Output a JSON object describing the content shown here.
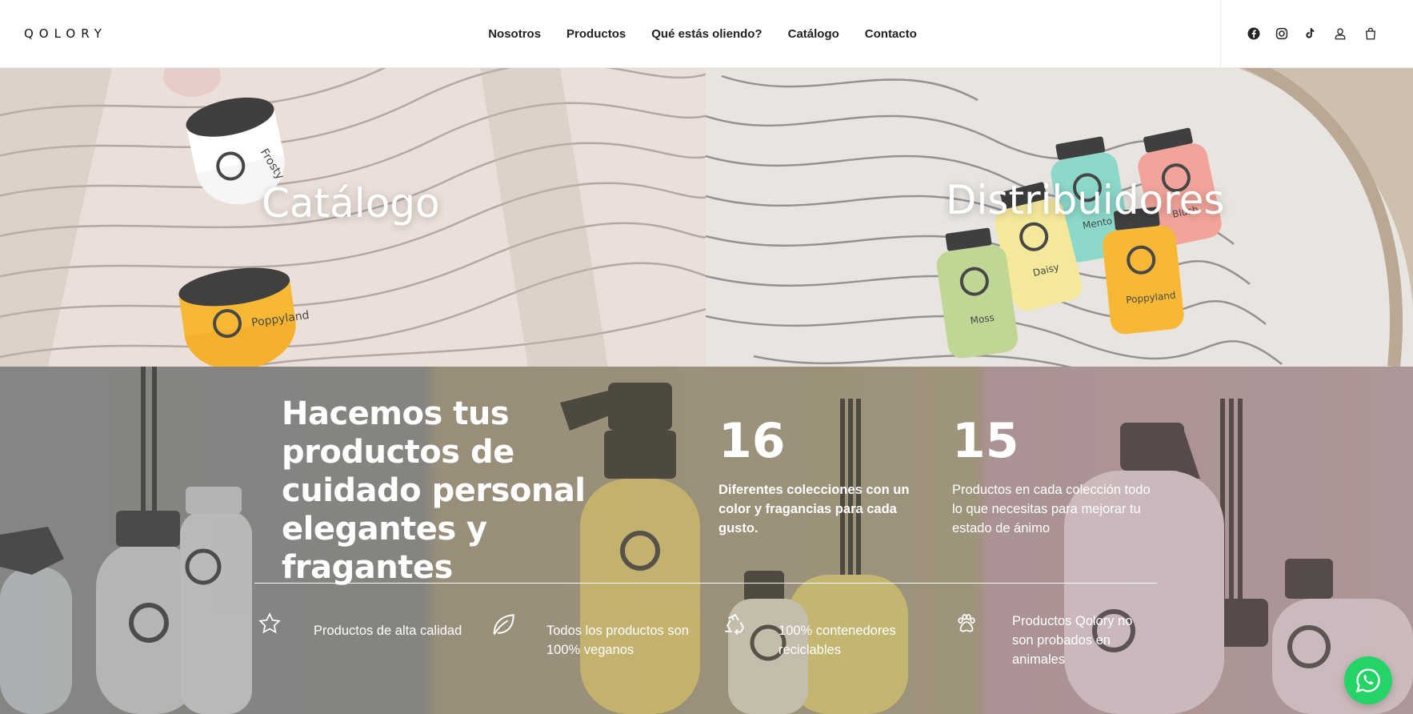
{
  "brand": {
    "logo": "QOLORY"
  },
  "nav": {
    "items": [
      {
        "label": "Nosotros"
      },
      {
        "label": "Productos"
      },
      {
        "label": "Qué estás oliendo?"
      },
      {
        "label": "Catálogo"
      },
      {
        "label": "Contacto"
      }
    ]
  },
  "header_icons": [
    "facebook-icon",
    "instagram-icon",
    "tiktok-icon",
    "user-icon",
    "cart-icon"
  ],
  "tiles": {
    "left": {
      "title": "Catálogo"
    },
    "right": {
      "title": "Distribuidores"
    }
  },
  "info": {
    "headline": "Hacemos tus productos de cuidado personal elegantes y fragantes",
    "stats": [
      {
        "number": "16",
        "text": "Diferentes colecciones con un color y fragancias para cada gusto."
      },
      {
        "number": "15",
        "text": "Productos en cada colección todo lo que necesitas para mejorar tu estado de ánimo"
      }
    ],
    "features": [
      {
        "icon": "star-icon",
        "text": "Productos de alta calidad"
      },
      {
        "icon": "leaf-icon",
        "text": "Todos los productos son 100% veganos"
      },
      {
        "icon": "recycle-icon",
        "text": "100% contenedores reciclables"
      },
      {
        "icon": "paw-icon",
        "text": "Productos Qolory no son probados en animales"
      }
    ]
  },
  "whatsapp": {
    "icon": "whatsapp-icon"
  },
  "colors": {
    "accent_yellow": "#f6b21f",
    "whatsapp_green": "#25d366",
    "mint": "#7fd4c6",
    "blush": "#f19a8f",
    "sage": "#b9d28a"
  }
}
